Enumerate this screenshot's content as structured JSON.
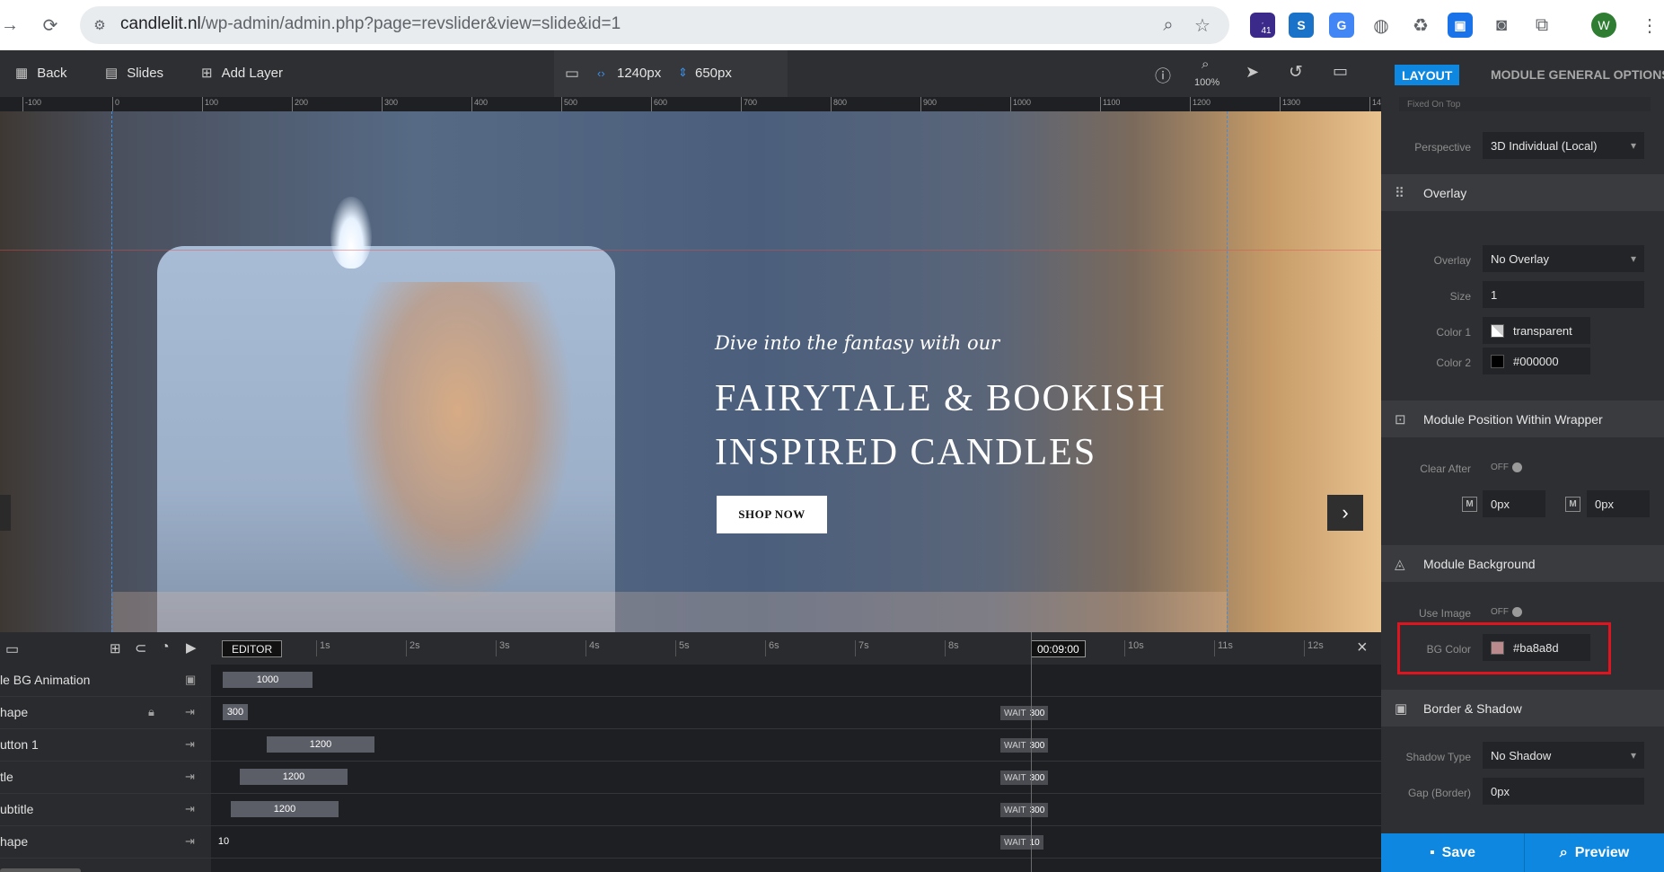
{
  "browser": {
    "url_host": "candlelit.nl",
    "url_path": "/wp-admin/admin.php?page=revslider&view=slide&id=1",
    "notification_count": "41",
    "avatar_letter": "W"
  },
  "toolbar": {
    "back_label": "Back",
    "slides_label": "Slides",
    "add_layer_label": "Add Layer",
    "width_value": "1240px",
    "height_value": "650px",
    "zoom_label": "100%"
  },
  "ruler": {
    "ticks": [
      "-100",
      "0",
      "100",
      "200",
      "300",
      "400",
      "500",
      "600",
      "700",
      "800",
      "900",
      "1000",
      "1100",
      "1200",
      "1300",
      "14"
    ]
  },
  "slide": {
    "subtitle": "Dive into the fantasy with our",
    "title_line1": "FAIRYTALE & BOOKISH",
    "title_line2": "INSPIRED CANDLES",
    "button_label": "SHOP NOW"
  },
  "timeline": {
    "editor_label": "EDITOR",
    "current_time": "00:09:00",
    "time_ticks": [
      "1s",
      "2s",
      "3s",
      "4s",
      "5s",
      "6s",
      "7s",
      "8s",
      "9s",
      "10s",
      "11s",
      "12s"
    ],
    "wait_label": "WAIT",
    "rows": [
      {
        "name": "le BG Animation",
        "start_value": "1000",
        "wait_value": ""
      },
      {
        "name": "hape",
        "start_value": "300",
        "wait_value": "300"
      },
      {
        "name": "utton 1",
        "start_value": "1200",
        "wait_value": "300"
      },
      {
        "name": "tle",
        "start_value": "1200",
        "wait_value": "300"
      },
      {
        "name": "ubtitle",
        "start_value": "1200",
        "wait_value": "300"
      },
      {
        "name": "hape",
        "start_value": "10",
        "wait_value": "10"
      }
    ]
  },
  "panel": {
    "tab_layout": "LAYOUT",
    "tab_general": "MODULE GENERAL OPTIONS",
    "partial_row": "Fixed On Top",
    "perspective_label": "Perspective",
    "perspective_value": "3D Individual (Local)",
    "overlay_section": "Overlay",
    "overlay_label": "Overlay",
    "overlay_value": "No Overlay",
    "size_label": "Size",
    "size_value": "1",
    "color1_label": "Color 1",
    "color1_value": "transparent",
    "color2_label": "Color 2",
    "color2_value": "#000000",
    "position_section": "Module Position Within Wrapper",
    "clear_after_label": "Clear After",
    "toggle_off": "OFF",
    "margin_tag": "M",
    "margin_top_value": "0px",
    "margin_bottom_value": "0px",
    "background_section": "Module Background",
    "use_image_label": "Use Image",
    "bg_color_label": "BG Color",
    "bg_color_value": "#ba8a8d",
    "border_section": "Border & Shadow",
    "shadow_type_label": "Shadow Type",
    "shadow_type_value": "No Shadow",
    "gap_label": "Gap (Border)",
    "gap_value": "0px",
    "save_label": "Save",
    "preview_label": "Preview"
  },
  "colors": {
    "accent": "#0e87e0",
    "bg_color_swatch": "#ba8a8d",
    "highlight": "#e0141e"
  }
}
